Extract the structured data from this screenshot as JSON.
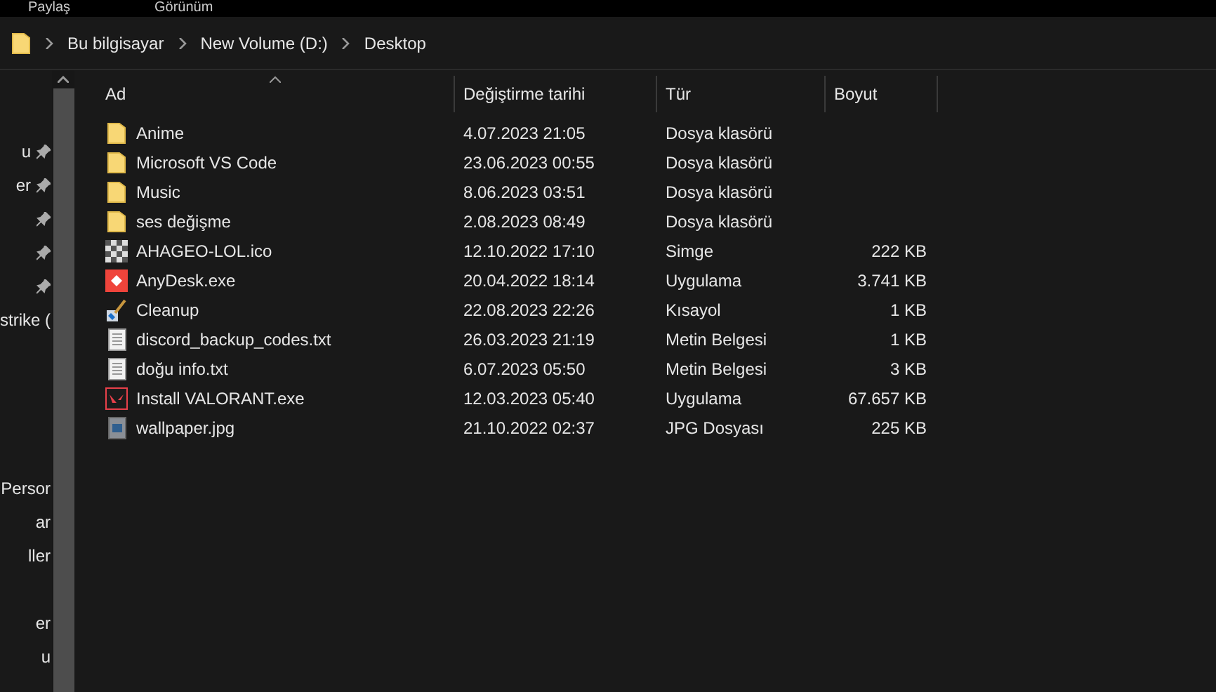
{
  "ribbon_tabs": [
    "Paylaş",
    "Görünüm"
  ],
  "breadcrumb": [
    "Bu bilgisayar",
    "New Volume (D:)",
    "Desktop"
  ],
  "sidebar": {
    "items": [
      {
        "label": "u",
        "pinned": true
      },
      {
        "label": "er",
        "pinned": true
      },
      {
        "pinned": true
      },
      {
        "pinned": true
      },
      {
        "pinned": true
      },
      {
        "label": "strike (",
        "pinned": false
      },
      {
        "pinned": false
      },
      {
        "pinned": false
      },
      {
        "pinned": false
      },
      {
        "pinned": false
      },
      {
        "label": " Persor",
        "pinned": false
      },
      {
        "label": "ar",
        "pinned": false
      },
      {
        "label": "ller",
        "pinned": false
      },
      {
        "pinned": false
      },
      {
        "label": "er",
        "pinned": false
      },
      {
        "label": "u",
        "pinned": false
      }
    ]
  },
  "table": {
    "columns": [
      "Ad",
      "Değiştirme tarihi",
      "Tür",
      "Boyut"
    ],
    "rows": [
      {
        "kind": "folder",
        "name": "Anime",
        "date": "4.07.2023 21:05",
        "type": "Dosya klasörü"
      },
      {
        "kind": "folder",
        "name": "Microsoft VS Code",
        "date": "23.06.2023 00:55",
        "type": "Dosya klasörü"
      },
      {
        "kind": "folder",
        "name": "Music",
        "date": "8.06.2023 03:51",
        "type": "Dosya klasörü"
      },
      {
        "kind": "folder",
        "name": "ses değişme",
        "date": "2.08.2023 08:49",
        "type": "Dosya klasörü"
      },
      {
        "kind": "icon",
        "name": "AHAGEO-LOL.ico",
        "date": "12.10.2022 17:10",
        "type": "Simge",
        "size": "222 KB"
      },
      {
        "kind": "anydesk",
        "name": "AnyDesk.exe",
        "date": "20.04.2022 18:14",
        "type": "Uygulama",
        "size": "3.741 KB"
      },
      {
        "kind": "shortcut",
        "name": "Cleanup",
        "date": "22.08.2023 22:26",
        "type": "Kısayol",
        "size": "1 KB"
      },
      {
        "kind": "text",
        "name": "discord_backup_codes.txt",
        "date": "26.03.2023 21:19",
        "type": "Metin Belgesi",
        "size": "1 KB"
      },
      {
        "kind": "text",
        "name": "doğu info.txt",
        "date": "6.07.2023 05:50",
        "type": "Metin Belgesi",
        "size": "3 KB"
      },
      {
        "kind": "valorant",
        "name": "Install VALORANT.exe",
        "date": "12.03.2023 05:40",
        "type": "Uygulama",
        "size": "67.657 KB"
      },
      {
        "kind": "image",
        "name": "wallpaper.jpg",
        "date": "21.10.2022 02:37",
        "type": "JPG Dosyası",
        "size": "225 KB"
      }
    ]
  }
}
